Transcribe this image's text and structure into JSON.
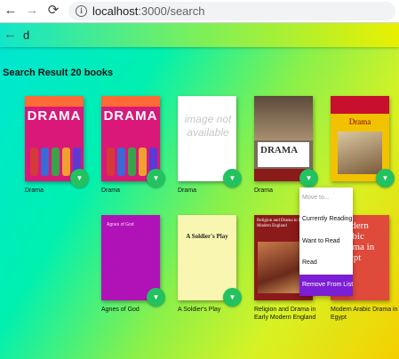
{
  "browser": {
    "url_host": "localhost",
    "url_path": ":3000/search",
    "nav": {
      "back": "←",
      "forward": "→",
      "reload": "⟳",
      "info": "i"
    }
  },
  "app": {
    "back_icon": "←",
    "search_value": "d",
    "results_title": "Search Result 20 books",
    "shelf_button_glyph": "▼",
    "books": [
      {
        "title": "Drama",
        "cover": "drama-comic"
      },
      {
        "title": "Drama",
        "cover": "drama-comic"
      },
      {
        "title": "Drama",
        "cover": "image-not-available"
      },
      {
        "title": "Drama",
        "cover": "oxford-drama"
      },
      {
        "title": "",
        "cover": "penguin-drama",
        "cover_title": "Drama"
      },
      {
        "title": "Agnes of God",
        "cover": "purple"
      },
      {
        "title": "A Soldier's Play",
        "cover": "yellow",
        "cover_title": "A Soldier's Play"
      },
      {
        "title": "Religion and Drama in Early Modern England",
        "cover": "religion"
      },
      {
        "title": "Modern Arabic Drama in Egypt",
        "cover": "arabic",
        "cover_title": "Modern Arabic Drama in Egypt"
      }
    ],
    "placeholder_cover_text": "image not available",
    "oxford_cover_title": "DRAMA",
    "drama_cover_word": "DRAMA",
    "menu": {
      "items": [
        {
          "label": "Move to...",
          "state": "disabled"
        },
        {
          "label": "Currently Reading",
          "state": "normal"
        },
        {
          "label": "Want to Read",
          "state": "normal"
        },
        {
          "label": "Read",
          "state": "normal"
        },
        {
          "label": "Remove From List",
          "state": "highlighted"
        }
      ]
    }
  },
  "colors": {
    "accent_green": "#23c15f",
    "menu_highlight": "#7c1ed4",
    "gradient_start": "#00e5d4",
    "gradient_end": "#f5d000"
  }
}
